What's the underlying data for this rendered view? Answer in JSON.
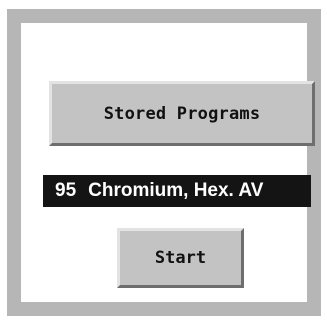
{
  "buttons": {
    "stored_programs": "Stored Programs",
    "start": "Start"
  },
  "program": {
    "number": "95",
    "name": "Chromium, Hex. AV"
  }
}
